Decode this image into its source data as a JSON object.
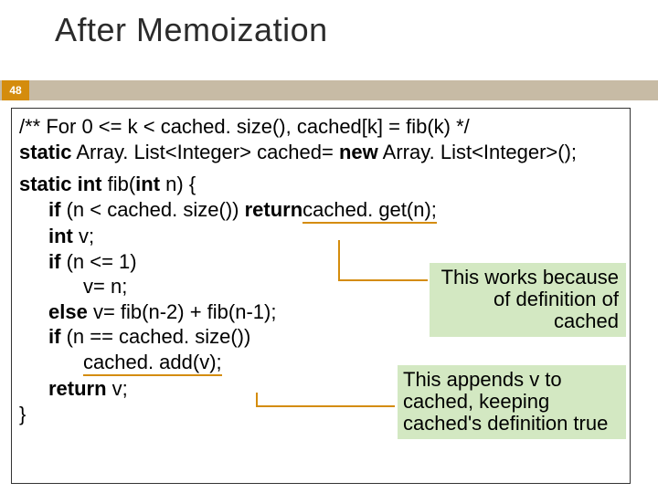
{
  "title": "After Memoization",
  "page": "48",
  "code": {
    "l1": "/** For  0 <= k < cached. size(),  cached[k] = fib(k) */",
    "l2a": "static",
    "l2b": " Array. List<Integer> cached=  ",
    "l2c": "new",
    "l2d": " Array. List<Integer>();",
    "l3a": "static int ",
    "l3b": "fib(",
    "l3c": "int",
    "l3d": " n) {",
    "l4a": "if",
    "l4b": " (n < cached. size()) ",
    "l4c": "return",
    "l4d": " cached. get(n);",
    "l5a": "int",
    "l5b": " v;",
    "l6a": "if",
    "l6b": " (n <= 1)",
    "l7": "v=  n;",
    "l8a": "else",
    "l8b": " v=  fib(n-2) + fib(n-1);",
    "l9a": "if",
    "l9b": " (n == cached. size())",
    "l10": "cached. add(v);",
    "l11a": "return",
    "l11b": " v;",
    "l12": "}"
  },
  "notes": {
    "n1": "This works because of definition of cached",
    "n2": "This appends v to cached, keeping cached's definition true"
  }
}
